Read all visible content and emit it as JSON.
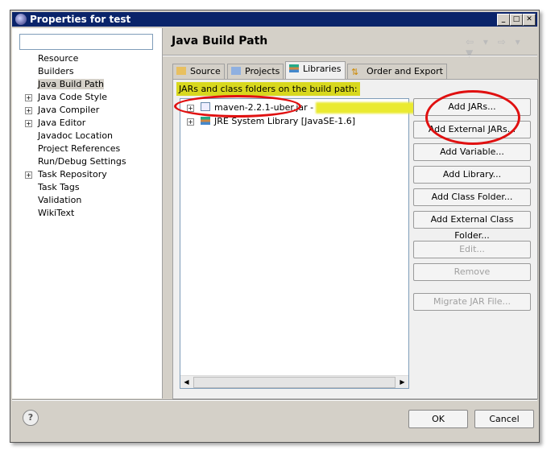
{
  "window": {
    "title": "Properties for test",
    "minimize": "_",
    "maximize": "□",
    "close": "✕"
  },
  "filter": {
    "value": ""
  },
  "tree": [
    {
      "label": "Resource",
      "expandable": false
    },
    {
      "label": "Builders",
      "expandable": false
    },
    {
      "label": "Java Build Path",
      "expandable": false,
      "selected": true
    },
    {
      "label": "Java Code Style",
      "expandable": true
    },
    {
      "label": "Java Compiler",
      "expandable": true
    },
    {
      "label": "Java Editor",
      "expandable": true
    },
    {
      "label": "Javadoc Location",
      "expandable": false
    },
    {
      "label": "Project References",
      "expandable": false
    },
    {
      "label": "Run/Debug Settings",
      "expandable": false
    },
    {
      "label": "Task Repository",
      "expandable": true
    },
    {
      "label": "Task Tags",
      "expandable": false
    },
    {
      "label": "Validation",
      "expandable": false
    },
    {
      "label": "WikiText",
      "expandable": false
    }
  ],
  "page": {
    "title": "Java Build Path",
    "nav": "⇦ ▾ ⇨ ▾ ▼"
  },
  "tabs": [
    {
      "label": "Source"
    },
    {
      "label": "Projects"
    },
    {
      "label": "Libraries",
      "active": true
    },
    {
      "label": "Order and Export"
    }
  ],
  "libraries": {
    "heading": "JARs and class folders on the build path:",
    "entries": [
      {
        "label": "maven-2.2.1-uber.jar - "
      },
      {
        "label": "JRE System Library [JavaSE-1.6]"
      }
    ]
  },
  "buttons": {
    "add_jars": "Add JARs...",
    "add_external_jars": "Add External JARs...",
    "add_variable": "Add Variable...",
    "add_library": "Add Library...",
    "add_class_folder": "Add Class Folder...",
    "add_external_class_folder": "Add External Class Folder...",
    "edit": "Edit...",
    "remove": "Remove",
    "migrate": "Migrate JAR File..."
  },
  "dialog": {
    "help": "?",
    "ok": "OK",
    "cancel": "Cancel"
  },
  "colors": {
    "highlight": "#d8d81e",
    "annotation": "#e01010",
    "titlebar": "#0a246a"
  }
}
